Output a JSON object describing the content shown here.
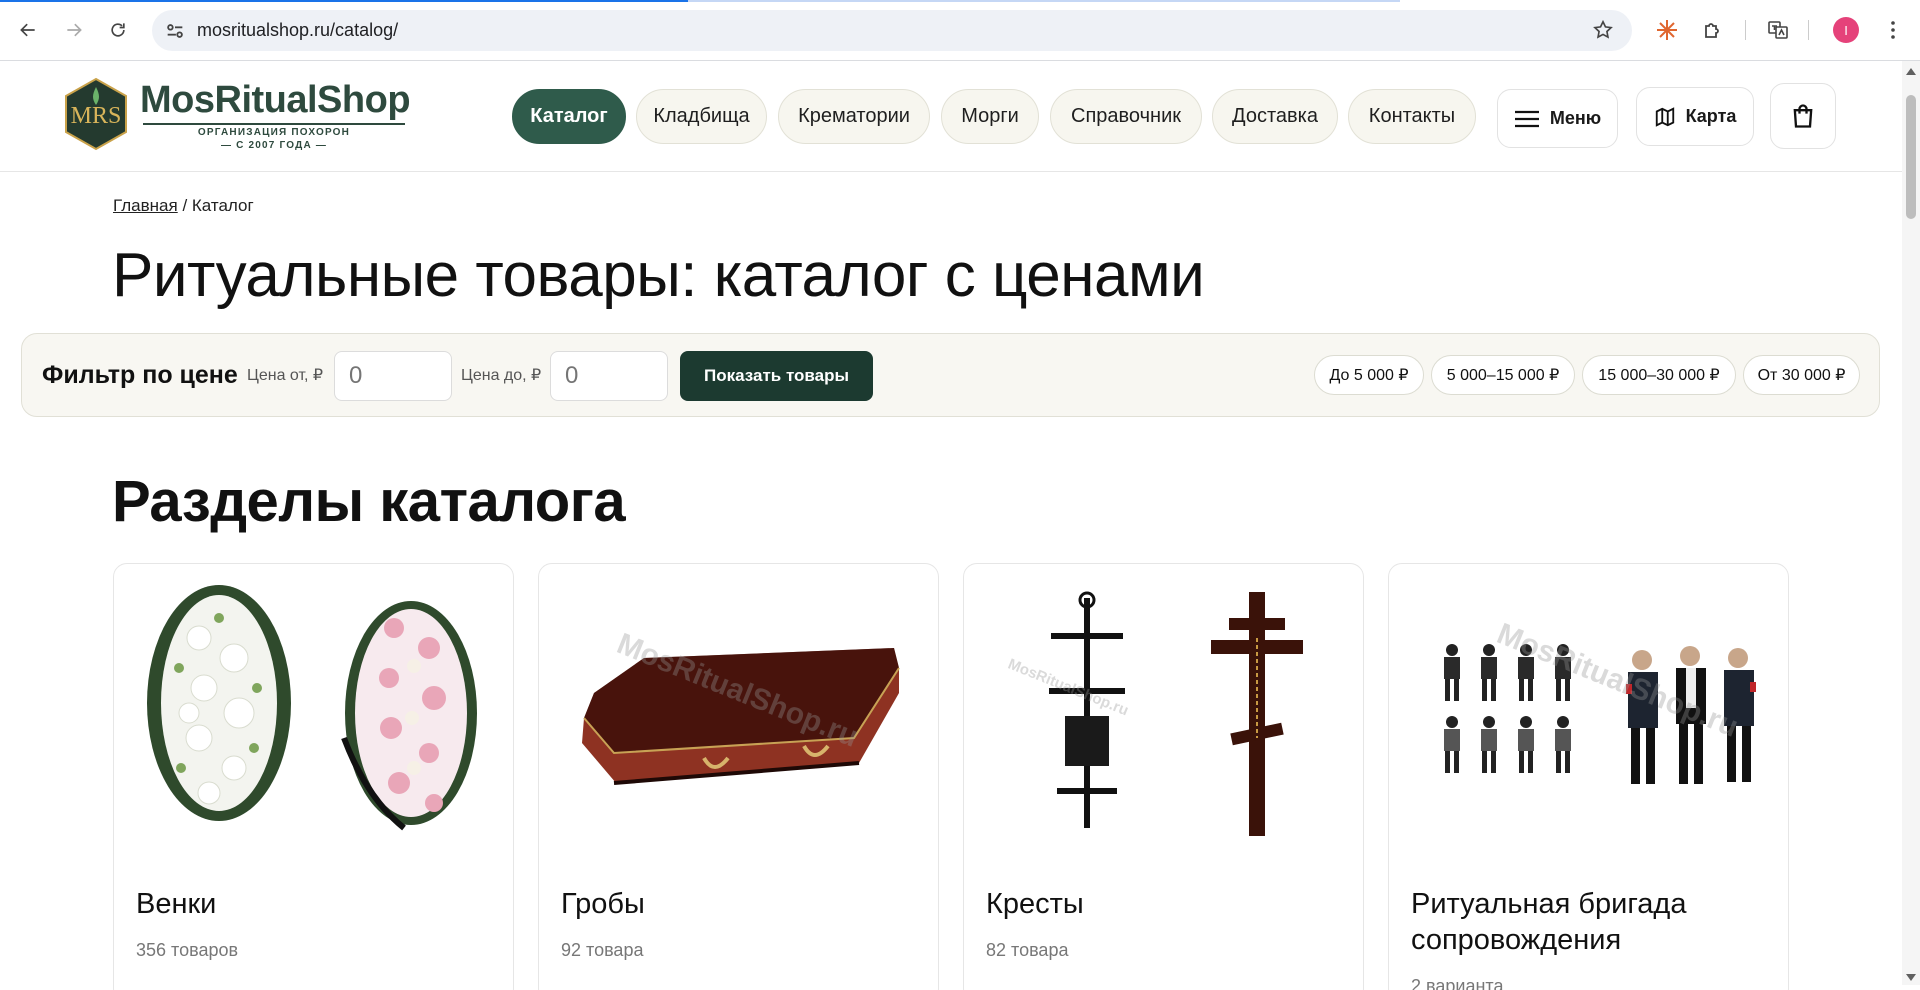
{
  "browser": {
    "url": "mosritualshop.ru/catalog/",
    "profile_initial": "I"
  },
  "logo": {
    "title": "MosRitualShop",
    "sub1": "ОРГАНИЗАЦИЯ ПОХОРОН",
    "sub2": "— С 2007 ГОДА —",
    "mark_text": "MRS"
  },
  "nav": {
    "items": [
      {
        "label": "Каталог",
        "active": true
      },
      {
        "label": "Кладбища"
      },
      {
        "label": "Крематории"
      },
      {
        "label": "Морги"
      },
      {
        "label": "Справочник"
      },
      {
        "label": "Доставка"
      },
      {
        "label": "Контакты"
      }
    ],
    "menu_label": "Меню",
    "map_label": "Карта"
  },
  "breadcrumb": {
    "home": "Главная",
    "separator": " / ",
    "current": "Каталог"
  },
  "page_title": "Ритуальные товары: каталог с ценами",
  "filter": {
    "title": "Фильтр по цене",
    "from_label": "Цена от, ₽",
    "to_label": "Цена до, ₽",
    "from_placeholder": "0",
    "to_placeholder": "0",
    "submit": "Показать товары",
    "chips": [
      "До 5 000 ₽",
      "5 000–15 000 ₽",
      "15 000–30 000 ₽",
      "От 30 000 ₽"
    ]
  },
  "section_title": "Разделы каталога",
  "cards": [
    {
      "title": "Венки",
      "count": "356 товаров"
    },
    {
      "title": "Гробы",
      "count": "92 товара"
    },
    {
      "title": "Кресты",
      "count": "82 товара"
    },
    {
      "title": "Ритуальная бригада сопровождения",
      "count": "2 варианта"
    }
  ],
  "watermark": "MosRitualShop.ru",
  "colors": {
    "brand_green": "#2f5b4b",
    "dark_green": "#1c3a30",
    "pill_bg": "#f7f6ef"
  }
}
